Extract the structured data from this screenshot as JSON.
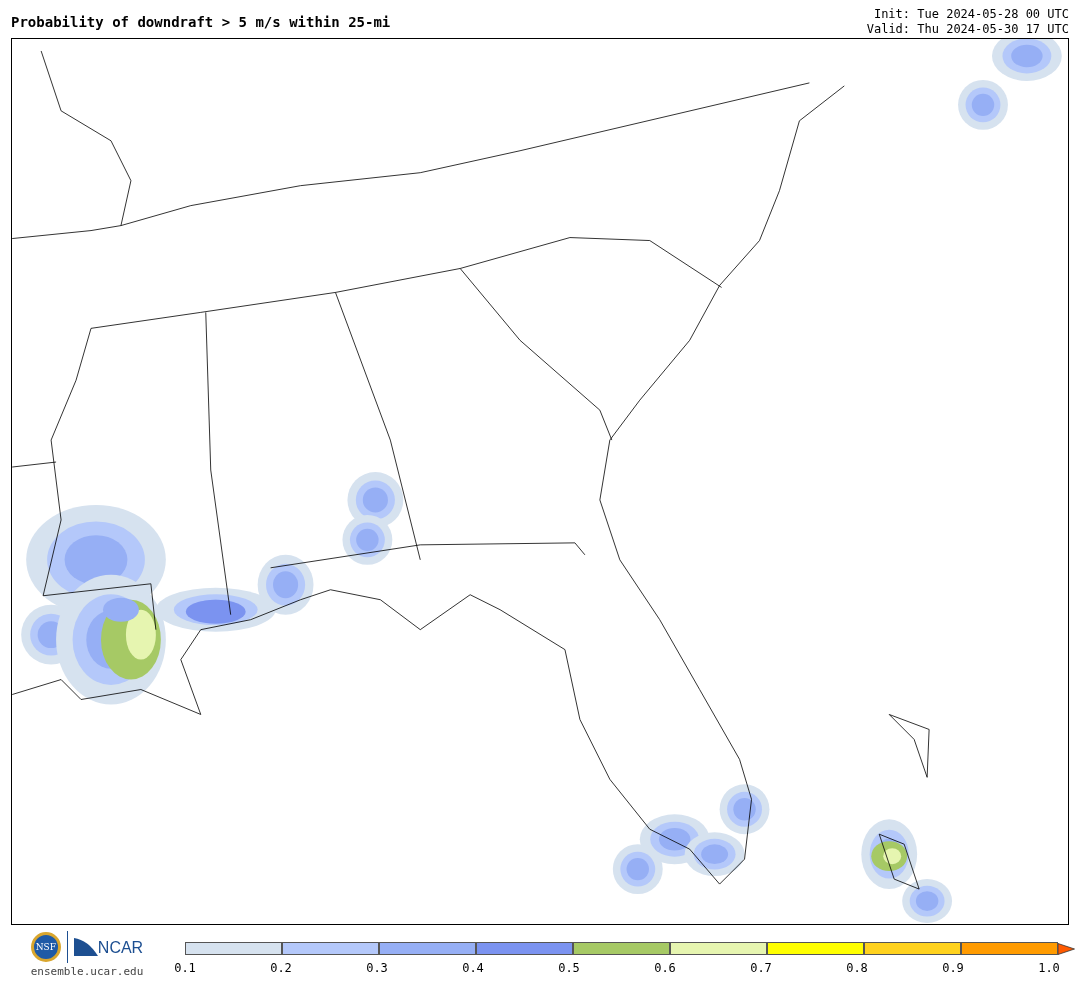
{
  "title": "Probability of downdraft > 5 m/s within 25-mi",
  "init": "Init: Tue 2024-05-28 00 UTC",
  "valid": "Valid: Thu 2024-05-30 17 UTC",
  "logos": {
    "nsf": "NSF",
    "ncar": "NCAR",
    "site": "ensemble.ucar.edu"
  },
  "colorbar": {
    "segments": [
      {
        "color": "#d6e2ef"
      },
      {
        "color": "#b4c8fa"
      },
      {
        "color": "#96aff5"
      },
      {
        "color": "#7b93f0"
      },
      {
        "color": "#a6c965"
      },
      {
        "color": "#e6f5b0"
      },
      {
        "color": "#ffff00"
      },
      {
        "color": "#ffd21e"
      },
      {
        "color": "#ff9b00"
      }
    ],
    "extend": {
      "color": "#ff5a00"
    },
    "ticks": [
      "0.1",
      "0.2",
      "0.3",
      "0.4",
      "0.5",
      "0.6",
      "0.7",
      "0.8",
      "0.9",
      "1.0"
    ]
  }
}
